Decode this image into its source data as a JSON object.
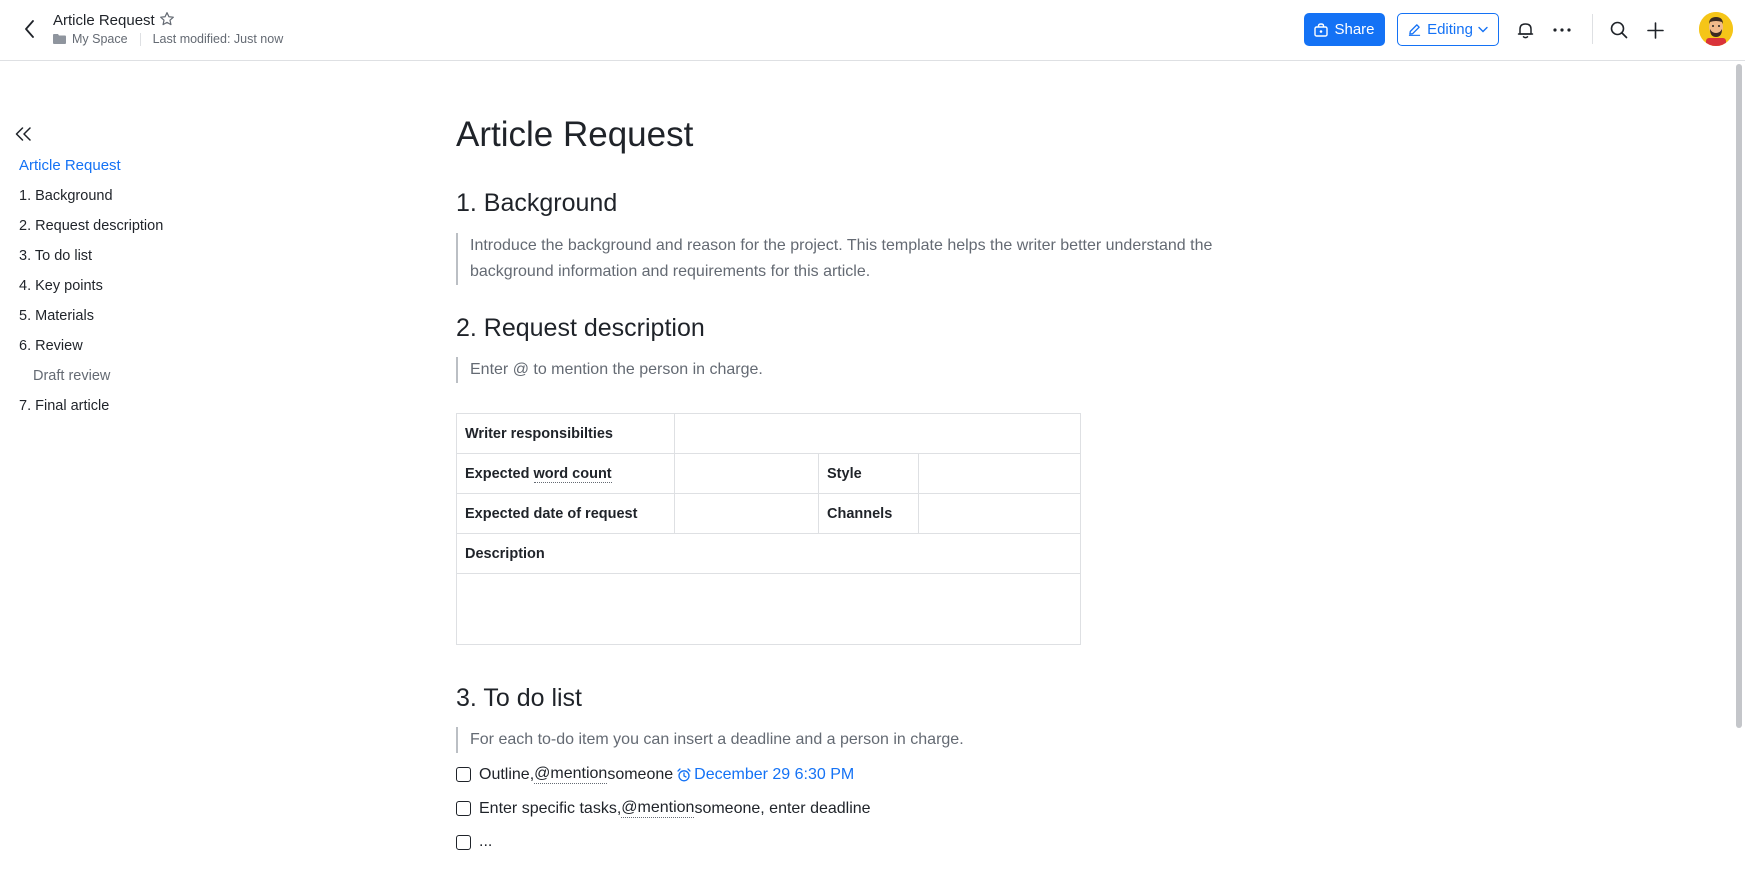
{
  "header": {
    "doc_title": "Article Request",
    "location": "My Space",
    "last_modified": "Last modified: Just now",
    "share_label": "Share",
    "editing_label": "Editing",
    "icons": [
      "back-icon",
      "star-icon",
      "folder-icon",
      "share-icon",
      "pen-icon",
      "chevron-down-icon",
      "bell-icon",
      "more-icon",
      "search-icon",
      "plus-icon"
    ],
    "accent_color": "#1472f5"
  },
  "outline": {
    "collapse_icon": "double-chevron-left-icon",
    "items": [
      {
        "label": "Article Request",
        "active": true
      },
      {
        "label": "1. Background"
      },
      {
        "label": "2. Request description"
      },
      {
        "label": "3. To do list"
      },
      {
        "label": "4. Key points"
      },
      {
        "label": "5. Materials"
      },
      {
        "label": "6. Review"
      },
      {
        "label": "Draft review",
        "sub": true
      },
      {
        "label": "7. Final article"
      }
    ]
  },
  "doc": {
    "title": "Article Request",
    "sections": {
      "background": {
        "heading": "1. Background",
        "quote_line1": "Introduce the background and reason for the project. This template helps the writer better understand the",
        "quote_line2": "background information and requirements for this article."
      },
      "request": {
        "heading": "2. Request description",
        "quote": "Enter @ to mention the person in charge.",
        "table": {
          "writer_responsibilities": "Writer responsibilties",
          "expected_word_count_prefix": "Expected ",
          "expected_word_count_term": "word count",
          "style": "Style",
          "expected_date": "Expected date of request",
          "channels": "Channels",
          "description": "Description"
        }
      },
      "todo": {
        "heading": "3. To do list",
        "quote": "For each to-do item you can insert a deadline and a person in charge.",
        "items": [
          {
            "prefix": "Outline, ",
            "mention": "@mention",
            "suffix": " someone",
            "deadline": "December 29 6:30 PM"
          },
          {
            "prefix": "Enter specific tasks, ",
            "mention": "@mention",
            "suffix": " someone, enter deadline"
          },
          {
            "prefix": "..."
          }
        ]
      }
    }
  }
}
